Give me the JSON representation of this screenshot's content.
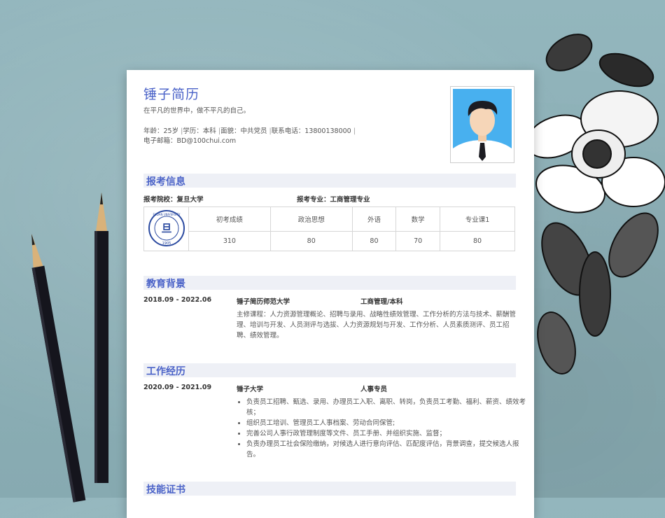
{
  "resume": {
    "name": "锤子简历",
    "motto": "在平凡的世界中，做不平凡的自己。",
    "info_line1": [
      "年龄：25岁",
      "学历：本科",
      "面貌：中共党员",
      "联系电话：13800138000"
    ],
    "email": "电子邮箱：BD@100chui.com"
  },
  "exam": {
    "title": "报考信息",
    "school": "报考院校：复旦大学",
    "major": "报考专业：工商管理专业",
    "headers": [
      "初考成绩",
      "政治思想",
      "外语",
      "数学",
      "专业课1"
    ],
    "scores": [
      "310",
      "80",
      "80",
      "70",
      "80"
    ],
    "logo_text": "FUDAN UNIVERSITY",
    "logo_year": "1905"
  },
  "education": {
    "title": "教育背景",
    "date": "2018.09 - 2022.06",
    "school": "锤子简历师范大学",
    "major": "工商管理/本科",
    "courses": "主修课程：人力资源管理概论、招聘与录用、战略性绩效管理、工作分析的方法与技术、薪酬管理、培训与开发、人员测评与选拔、人力资源规划与开发、工作分析、人员素质测评、员工招聘、绩效管理。"
  },
  "work": {
    "title": "工作经历",
    "date": "2020.09 - 2021.09",
    "company": "锤子大学",
    "role": "人事专员",
    "duties": [
      "负责员工招聘、甄选、录用、办理员工入职、离职、转岗，负责员工考勤、福利、薪资、绩效考核；",
      "组织员工培训、管理员工人事档案、劳动合同保管;",
      "完善公司人事行政管理制度等文件、员工手册、并组织实施、监督；",
      "负责办理员工社会保险缴纳，对候选人进行意向评估、匹配度评估，背景调查，提交候选人报告。"
    ]
  },
  "skills": {
    "title": "技能证书"
  },
  "colors": {
    "accent": "#4b63c8",
    "background": "#8fb1b8",
    "section_bg": "#eef0f6"
  }
}
